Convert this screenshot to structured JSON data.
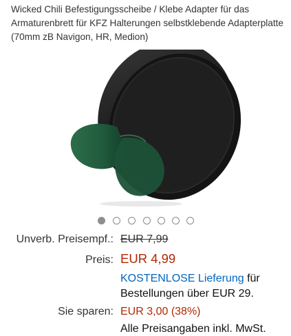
{
  "product": {
    "title": "Wicked Chili Befestigungsscheibe / Klebe Adapter für das Armaturenbrett für KFZ Halterungen selbstklebende Adapterplatte (70mm zB Navigon, HR, Medion)"
  },
  "image": {
    "icon": "adhesive-disc-product-image",
    "disc_color": "#1c1c1c",
    "film_color": "#1f5a3c"
  },
  "carousel": {
    "total": 7,
    "active_index": 0
  },
  "pricing": {
    "rrp_label": "Unverb. Preisempf.:",
    "rrp_value": "EUR 7,99",
    "price_label": "Preis:",
    "price_value": "EUR 4,99",
    "shipping_link": "KOSTENLOSE Lieferung",
    "shipping_rest": " für Bestellungen über EUR 29.",
    "savings_label": "Sie sparen:",
    "savings_value": "EUR 3,00 (38%)",
    "footnote": "Alle Preisangaben inkl. MwSt."
  },
  "colors": {
    "price_red": "#b12704",
    "link_blue": "#0066c0"
  }
}
